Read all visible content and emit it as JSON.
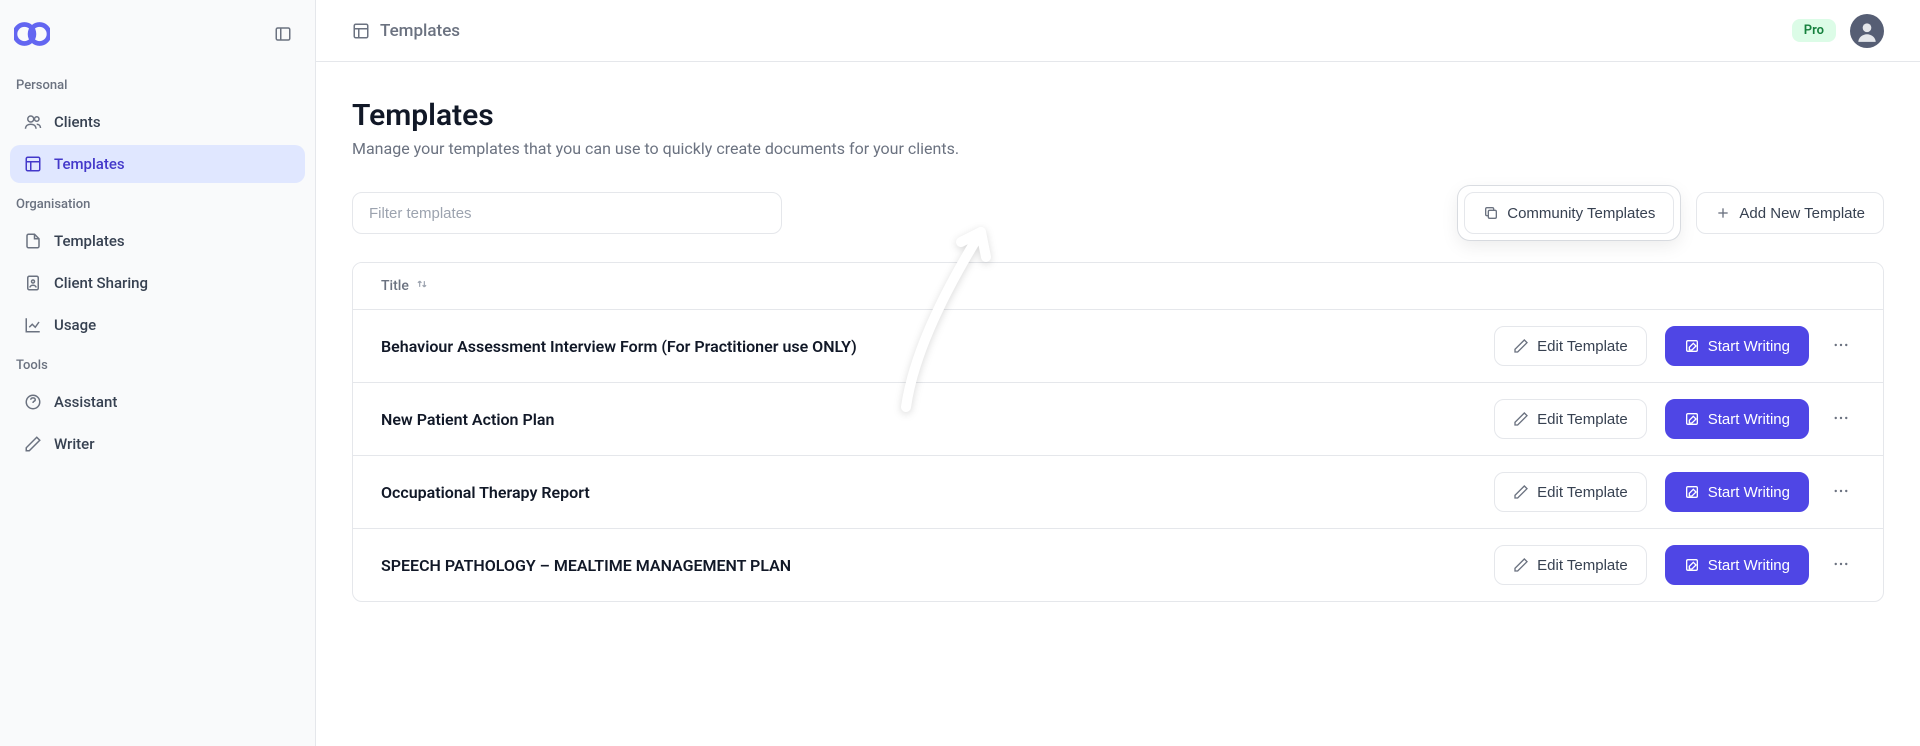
{
  "sidebar": {
    "personal_label": "Personal",
    "personal_items": [
      {
        "label": "Clients",
        "icon": "users-icon",
        "active": false
      },
      {
        "label": "Templates",
        "icon": "template-icon",
        "active": true
      }
    ],
    "organisation_label": "Organisation",
    "organisation_items": [
      {
        "label": "Templates",
        "icon": "file-icon"
      },
      {
        "label": "Client Sharing",
        "icon": "badge-icon"
      },
      {
        "label": "Usage",
        "icon": "chart-icon"
      }
    ],
    "tools_label": "Tools",
    "tools_items": [
      {
        "label": "Assistant",
        "icon": "help-icon"
      },
      {
        "label": "Writer",
        "icon": "pen-icon"
      }
    ]
  },
  "topbar": {
    "breadcrumb_label": "Templates",
    "pro_badge": "Pro"
  },
  "page": {
    "title": "Templates",
    "subtitle": "Manage your templates that you can use to quickly create documents for your clients.",
    "filter_placeholder": "Filter templates",
    "community_btn": "Community Templates",
    "add_btn": "Add New Template",
    "edit_label": "Edit Template",
    "start_label": "Start Writing"
  },
  "table": {
    "title_header": "Title",
    "rows": [
      {
        "title": "Behaviour Assessment Interview Form (For Practitioner use ONLY)"
      },
      {
        "title": " New Patient Action Plan"
      },
      {
        "title": "Occupational Therapy Report"
      },
      {
        "title": "SPEECH PATHOLOGY – MEALTIME MANAGEMENT PLAN"
      }
    ]
  }
}
